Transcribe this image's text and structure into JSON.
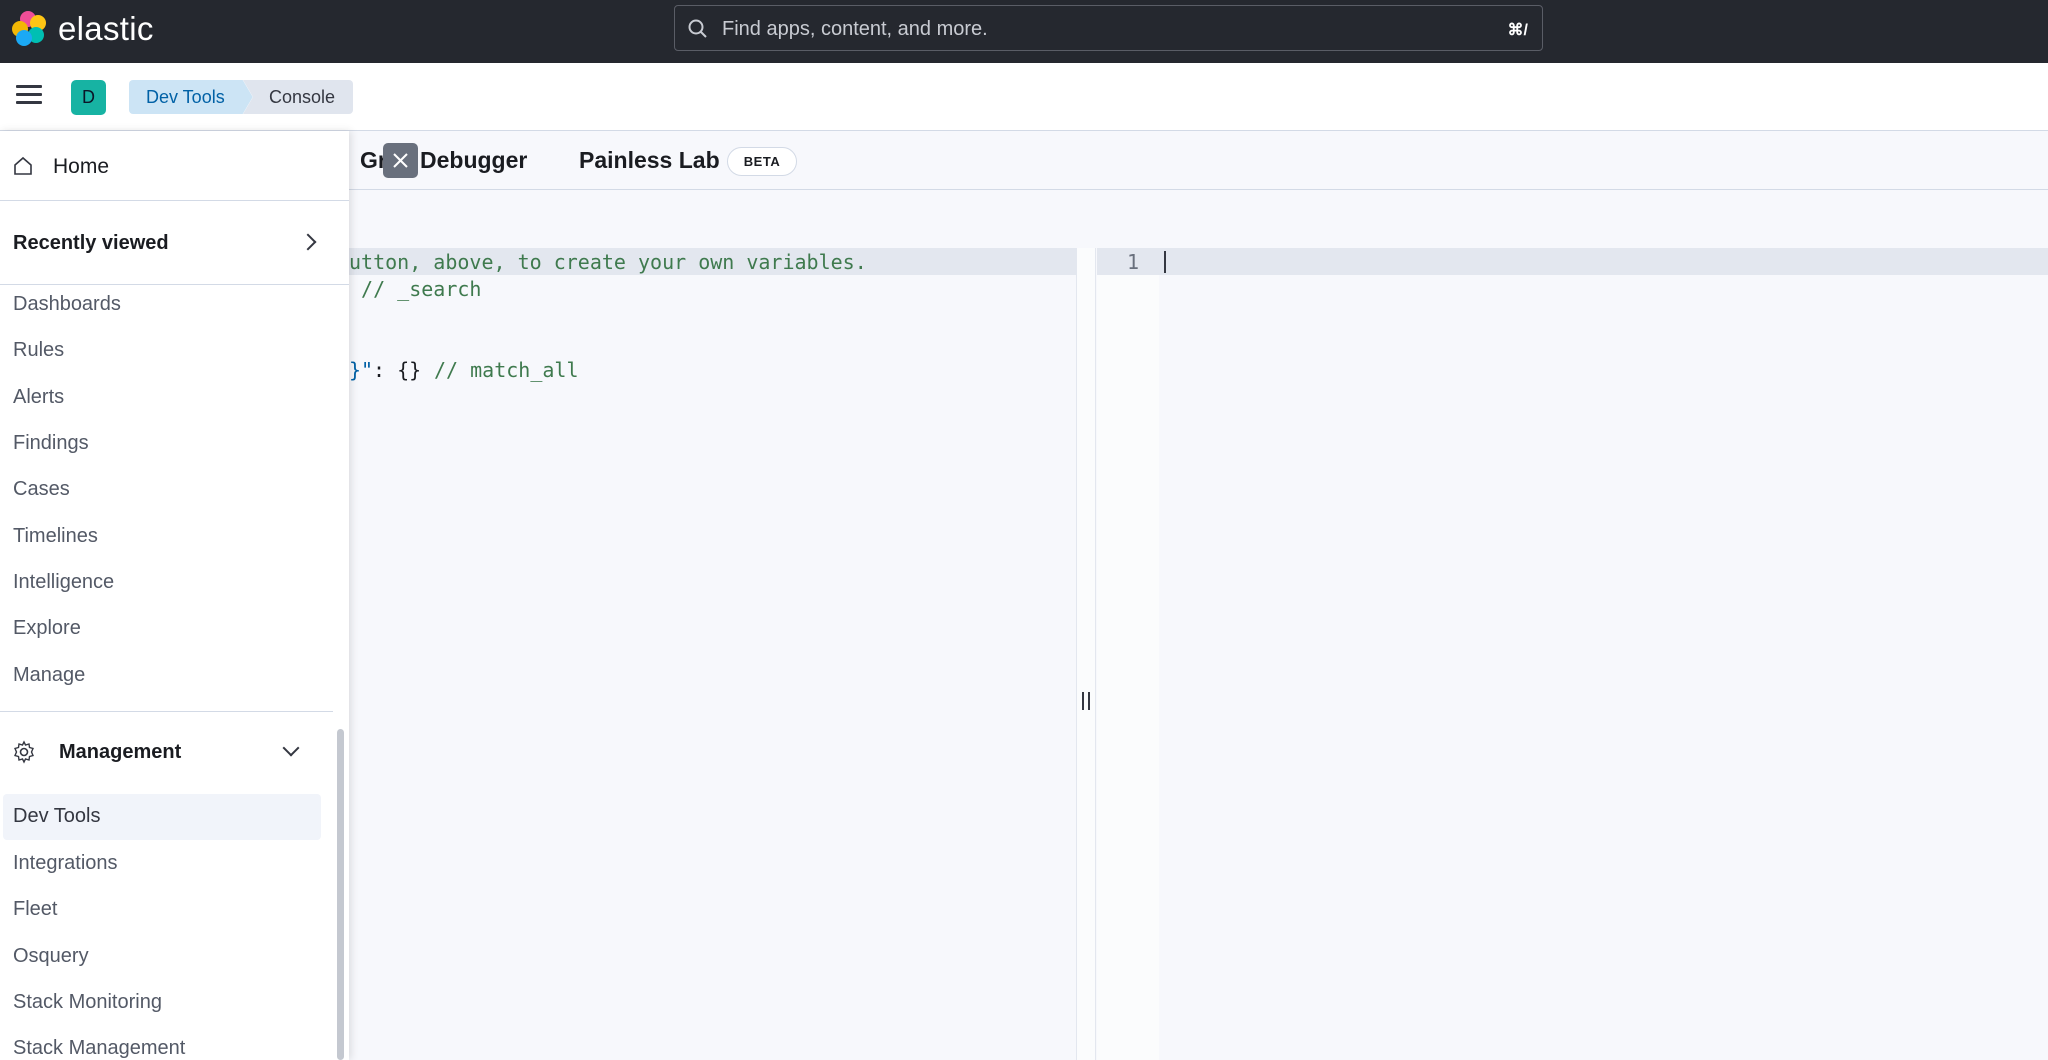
{
  "header": {
    "brand": "elastic",
    "search_placeholder": "Find apps, content, and more.",
    "search_shortcut": "⌘/"
  },
  "breadcrumbs": [
    {
      "label": "Dev Tools"
    },
    {
      "label": "Console"
    }
  ],
  "avatar": {
    "initial": "D"
  },
  "tabs": {
    "grok_visible": "Gr",
    "grok_visible_rest": "Debugger",
    "painless": "Painless Lab",
    "beta_badge": "BETA"
  },
  "editor": {
    "line1": "utton, above, to create your own variables.",
    "line2": " // _search",
    "line4_a": "}\"",
    "line4_b": ": {} ",
    "line4_c": "// match_all",
    "output_line_number": "1"
  },
  "sidenav": {
    "home": "Home",
    "recently_viewed": "Recently viewed",
    "security_items": [
      "Dashboards",
      "Rules",
      "Alerts",
      "Findings",
      "Cases",
      "Timelines",
      "Intelligence",
      "Explore",
      "Manage"
    ],
    "management": "Management",
    "management_items": [
      "Dev Tools",
      "Integrations",
      "Fleet",
      "Osquery",
      "Stack Monitoring",
      "Stack Management"
    ]
  },
  "colors": {
    "header_bg": "#25282f",
    "accent": "#0061a6",
    "avatar_bg": "#17b3a3",
    "code_comment": "#3f7a4e"
  }
}
